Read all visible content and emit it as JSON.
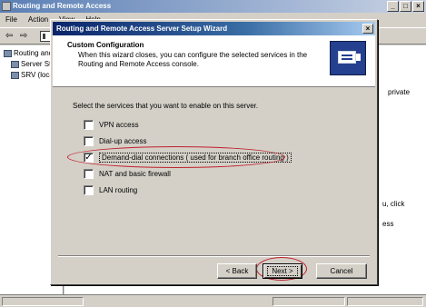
{
  "background_window": {
    "title": "Routing and Remote Access",
    "window_buttons": [
      "_",
      "□",
      "×"
    ],
    "menu": [
      "File",
      "Action",
      "View",
      "Help"
    ],
    "toolbar_icons": [
      "back-arrow-icon",
      "forward-arrow-icon",
      "show-tree-icon"
    ],
    "tree_items": [
      {
        "label": "Routing and Remote Access"
      },
      {
        "label": "Server Status"
      },
      {
        "label": "SRV (local)"
      }
    ],
    "right_pane_fragments": [
      "private",
      "u, click",
      "ess"
    ]
  },
  "wizard": {
    "title": "Routing and Remote Access Server Setup Wizard",
    "close_label": "×",
    "header_title": "Custom Configuration",
    "header_subtitle": "When this wizard closes, you can configure the selected services in the Routing and Remote Access console.",
    "logo_icon": "server-mailbox-icon",
    "prompt": "Select the services that you want to enable on this server.",
    "options": [
      {
        "label": "VPN access",
        "checked": false
      },
      {
        "label": "Dial-up access",
        "checked": false
      },
      {
        "label": "Demand-dial connections ( used for branch office routing )",
        "checked": true
      },
      {
        "label": "NAT and basic firewall",
        "checked": false
      },
      {
        "label": "LAN routing",
        "checked": false
      }
    ],
    "buttons": {
      "back": "< Back",
      "next": "Next >",
      "cancel": "Cancel"
    },
    "highlight_color": "#c0202c"
  }
}
